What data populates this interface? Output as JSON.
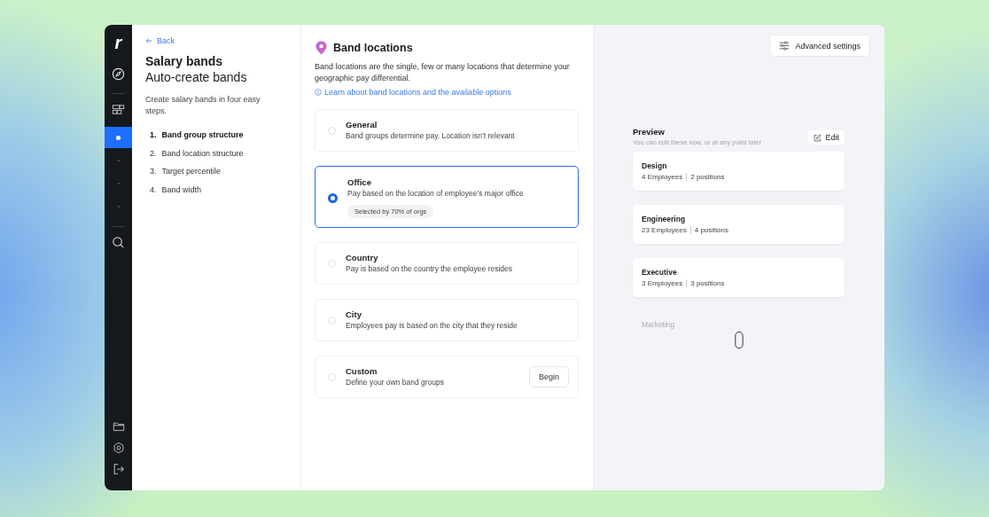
{
  "rail": {
    "logo": "r",
    "steps": [
      {
        "selected": true
      },
      {
        "selected": false
      },
      {
        "selected": false
      },
      {
        "selected": false
      }
    ]
  },
  "sidebar": {
    "back": "Back",
    "title": "Salary bands",
    "subtitle": "Auto-create bands",
    "intro": "Create salary bands in four easy steps.",
    "steps": [
      {
        "number": "1.",
        "label": "Band group structure",
        "selected": true
      },
      {
        "number": "2.",
        "label": "Band location structure",
        "selected": false
      },
      {
        "number": "3.",
        "label": "Target percentile",
        "selected": false
      },
      {
        "number": "4.",
        "label": "Band width",
        "selected": false
      }
    ]
  },
  "main": {
    "title": "Band locations",
    "description": "Band locations are the single, few or many locations that determine your geographic pay differential.",
    "link": "Learn about band locations and the available options",
    "options": [
      {
        "title": "General",
        "description": "Band groups determine pay. Location isn’t relevant",
        "selected": false
      },
      {
        "title": "Office",
        "description": "Pay based on the location of employee’s major office",
        "badge": "Selected by 70% of orgs",
        "selected": true
      },
      {
        "title": "Country",
        "description": "Pay is based on the country the employee resides",
        "selected": false
      },
      {
        "title": "City",
        "description": "Employees pay is based on the city that they reside",
        "selected": false
      },
      {
        "title": "Custom",
        "description": "Define your own band groups",
        "action": "Begin",
        "selected": false
      }
    ]
  },
  "preview": {
    "advanced_button": "Advanced settings",
    "title": "Preview",
    "subtitle": "You can edit these now, or at any point later",
    "edit_button": "Edit",
    "groups": [
      {
        "name": "Design",
        "employees": "4 Employees",
        "positions": "2 positions",
        "faded": false
      },
      {
        "name": "Engineering",
        "employees": "23 Employees",
        "positions": "4 positions",
        "faded": false
      },
      {
        "name": "Executive",
        "employees": "3 Employees",
        "positions": "3 positions",
        "faded": false
      },
      {
        "name": "Marketing",
        "faded": true
      }
    ]
  }
}
